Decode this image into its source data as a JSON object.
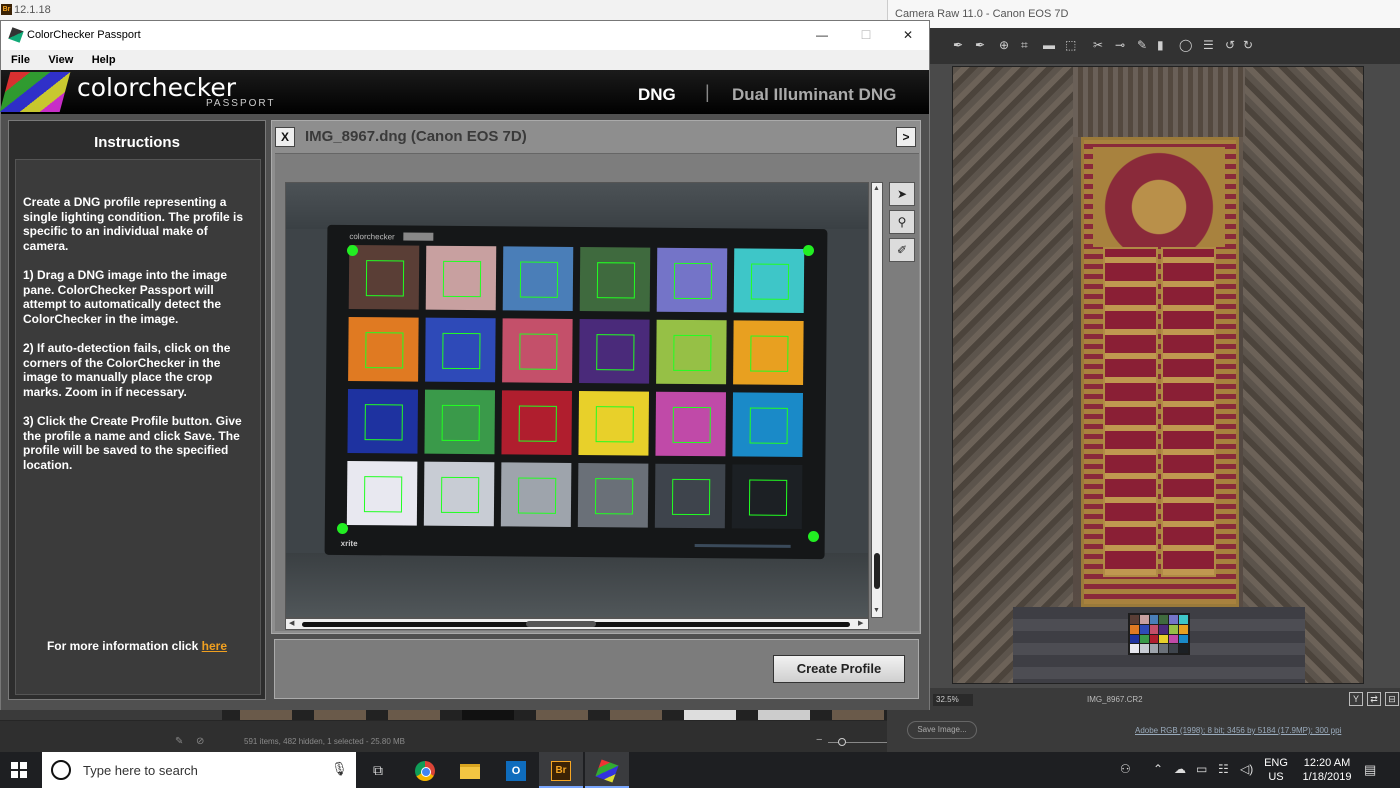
{
  "bridge": {
    "title": "12.1.18",
    "badge": "Br",
    "status_text": "591 items, 482 hidden, 1 selected - 25.80 MB"
  },
  "camera_raw": {
    "title": "Camera Raw 11.0  -  Canon EOS 7D",
    "zoom": "32.5%",
    "filename": "IMG_8967.CR2",
    "save_label": "Save Image...",
    "workflow_info": "Adobe RGB (1998); 8 bit; 3456 by 5184 (17.9MP); 300 ppi"
  },
  "colorchecker": {
    "window_title": "ColorChecker Passport",
    "menu": [
      "File",
      "View",
      "Help"
    ],
    "logo_bold": "colorchecker",
    "logo_sub": "PASSPORT",
    "mode_dng": "DNG",
    "mode_separator": "|",
    "mode_dual": "Dual Illuminant DNG",
    "instructions": {
      "title": "Instructions",
      "para1": "Create a DNG profile representing a single lighting condition. The profile is specific to an individual make of camera.",
      "para2": "1) Drag a DNG image into the image pane. ColorChecker Passport will attempt to automatically detect the ColorChecker in the image.",
      "para3": "2) If auto-detection fails, click on the corners of the ColorChecker in the image to manually place the crop marks. Zoom in if necessary.",
      "para4": "3) Click the Create Profile button. Give the profile a name and click Save. The profile will be saved to the specified location.",
      "more_prefix": "For more information click ",
      "more_link": "here"
    },
    "image_panel": {
      "close_label": "X",
      "title": "IMG_8967.dng (Canon EOS 7D)",
      "next_label": ">",
      "checker_brand": "colorchecker",
      "checker_maker": "xrite",
      "patch_colors": [
        "#5a3e36",
        "#c8a0a0",
        "#4a7eb8",
        "#3f6a3e",
        "#7474c8",
        "#3ec6c8",
        "#e07a22",
        "#2e4ab8",
        "#c4506a",
        "#4a2a7a",
        "#96c046",
        "#e8a020",
        "#1e32a0",
        "#3a9a4a",
        "#b01e2e",
        "#e8d02a",
        "#c04aa8",
        "#1a8ac8",
        "#e8e8f0",
        "#c8ccd4",
        "#9ea4ac",
        "#6a7078",
        "#3e444c",
        "#1c2024"
      ]
    },
    "side_tools": [
      "arrow-plus",
      "magnifier",
      "eraser"
    ],
    "create_profile": "Create Profile"
  },
  "taskbar": {
    "search_placeholder": "Type here to search",
    "bridge_label": "Br",
    "outlook_label": "O",
    "lang_top": "ENG",
    "lang_bottom": "US",
    "time": "12:20 AM",
    "date": "1/18/2019"
  }
}
